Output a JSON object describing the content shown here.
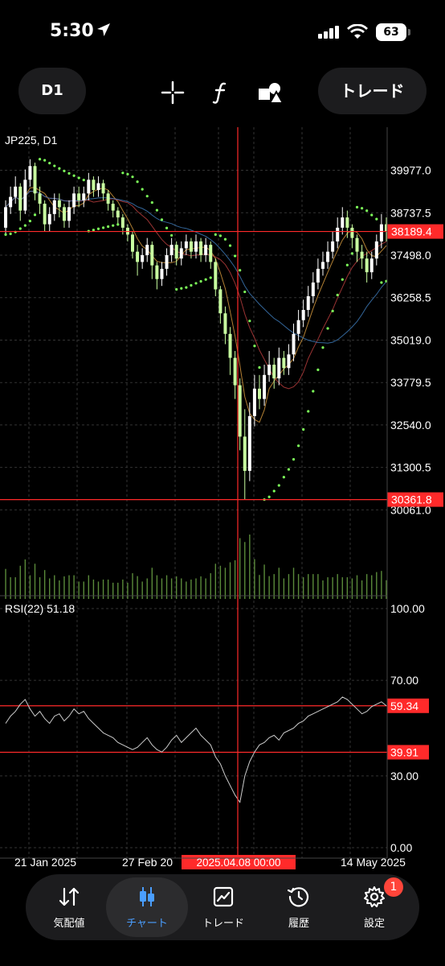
{
  "status_bar": {
    "time": "5:30",
    "battery": "63"
  },
  "toolbar": {
    "timeframe": "D1",
    "trade_button": "トレード"
  },
  "chart_data": [
    {
      "type": "candlestick",
      "title": "JP225, D1",
      "y_ticks": [
        "39977.0",
        "38737.5",
        "37498.0",
        "36258.5",
        "35019.0",
        "33779.5",
        "32540.0",
        "31300.5",
        "30061.0"
      ],
      "price_lines": [
        {
          "label": "38189.4",
          "value": 38189.4
        },
        {
          "label": "30361.8",
          "value": 30361.8
        }
      ],
      "ylim": [
        29600,
        41000
      ],
      "x_ticks": [
        "21 Jan 2025",
        "27 Feb 20",
        "14 May 2025"
      ],
      "crosshair_label": "2025.04.08 00:00",
      "candles": [
        {
          "o": 38300,
          "c": 38900,
          "h": 39100,
          "l": 38100
        },
        {
          "o": 38900,
          "c": 39200,
          "h": 39500,
          "l": 38700
        },
        {
          "o": 39200,
          "c": 39500,
          "h": 39800,
          "l": 39000
        },
        {
          "o": 39500,
          "c": 38800,
          "h": 39600,
          "l": 38500
        },
        {
          "o": 38800,
          "c": 39700,
          "h": 40000,
          "l": 38700
        },
        {
          "o": 39700,
          "c": 40100,
          "h": 40300,
          "l": 39500
        },
        {
          "o": 40100,
          "c": 39300,
          "h": 40200,
          "l": 39100
        },
        {
          "o": 39300,
          "c": 39000,
          "h": 39500,
          "l": 38700
        },
        {
          "o": 39000,
          "c": 38400,
          "h": 39100,
          "l": 38200
        },
        {
          "o": 38400,
          "c": 38700,
          "h": 38900,
          "l": 38200
        },
        {
          "o": 38700,
          "c": 39100,
          "h": 39300,
          "l": 38500
        },
        {
          "o": 39100,
          "c": 38900,
          "h": 39300,
          "l": 38600
        },
        {
          "o": 38900,
          "c": 38500,
          "h": 39000,
          "l": 38300
        },
        {
          "o": 38500,
          "c": 38900,
          "h": 39100,
          "l": 38300
        },
        {
          "o": 38900,
          "c": 39300,
          "h": 39500,
          "l": 38700
        },
        {
          "o": 39300,
          "c": 39100,
          "h": 39500,
          "l": 38900
        },
        {
          "o": 39100,
          "c": 39300,
          "h": 39500,
          "l": 38900
        },
        {
          "o": 39300,
          "c": 39700,
          "h": 39900,
          "l": 39100
        },
        {
          "o": 39700,
          "c": 39400,
          "h": 39800,
          "l": 39200
        },
        {
          "o": 39400,
          "c": 39600,
          "h": 39800,
          "l": 39200
        },
        {
          "o": 39600,
          "c": 39300,
          "h": 39700,
          "l": 39100
        },
        {
          "o": 39300,
          "c": 39000,
          "h": 39400,
          "l": 38800
        },
        {
          "o": 39000,
          "c": 38800,
          "h": 39100,
          "l": 38600
        },
        {
          "o": 38800,
          "c": 38600,
          "h": 38900,
          "l": 38400
        },
        {
          "o": 38600,
          "c": 38300,
          "h": 38700,
          "l": 38100
        },
        {
          "o": 38300,
          "c": 38100,
          "h": 38400,
          "l": 37900
        },
        {
          "o": 38100,
          "c": 37600,
          "h": 38200,
          "l": 37400
        },
        {
          "o": 37600,
          "c": 37300,
          "h": 37800,
          "l": 36900
        },
        {
          "o": 37300,
          "c": 37500,
          "h": 37700,
          "l": 37100
        },
        {
          "o": 37500,
          "c": 37800,
          "h": 38000,
          "l": 37300
        },
        {
          "o": 37800,
          "c": 37200,
          "h": 37900,
          "l": 36800
        },
        {
          "o": 37200,
          "c": 36800,
          "h": 37300,
          "l": 36500
        },
        {
          "o": 36800,
          "c": 37100,
          "h": 37300,
          "l": 36600
        },
        {
          "o": 37100,
          "c": 37500,
          "h": 37700,
          "l": 36900
        },
        {
          "o": 37500,
          "c": 37800,
          "h": 38000,
          "l": 37300
        },
        {
          "o": 37800,
          "c": 37400,
          "h": 37900,
          "l": 37200
        },
        {
          "o": 37400,
          "c": 37700,
          "h": 37900,
          "l": 37200
        },
        {
          "o": 37700,
          "c": 37900,
          "h": 38100,
          "l": 37500
        },
        {
          "o": 37900,
          "c": 37600,
          "h": 38000,
          "l": 37400
        },
        {
          "o": 37600,
          "c": 37900,
          "h": 38100,
          "l": 37400
        },
        {
          "o": 37900,
          "c": 37500,
          "h": 38000,
          "l": 37300
        },
        {
          "o": 37500,
          "c": 37800,
          "h": 38000,
          "l": 37300
        },
        {
          "o": 37800,
          "c": 37300,
          "h": 37900,
          "l": 37100
        },
        {
          "o": 37300,
          "c": 36500,
          "h": 37400,
          "l": 36300
        },
        {
          "o": 36500,
          "c": 35800,
          "h": 36600,
          "l": 35500
        },
        {
          "o": 35800,
          "c": 35200,
          "h": 36000,
          "l": 34900
        },
        {
          "o": 35200,
          "c": 34500,
          "h": 35400,
          "l": 34000
        },
        {
          "o": 34500,
          "c": 33700,
          "h": 34700,
          "l": 33300
        },
        {
          "o": 33700,
          "c": 32200,
          "h": 33900,
          "l": 31800
        },
        {
          "o": 32200,
          "c": 31200,
          "h": 33000,
          "l": 30361.8
        },
        {
          "o": 31200,
          "c": 32800,
          "h": 33200,
          "l": 30900
        },
        {
          "o": 32800,
          "c": 33600,
          "h": 34000,
          "l": 32500
        },
        {
          "o": 33600,
          "c": 33300,
          "h": 34000,
          "l": 33000
        },
        {
          "o": 33300,
          "c": 34000,
          "h": 34300,
          "l": 33100
        },
        {
          "o": 34000,
          "c": 34300,
          "h": 34700,
          "l": 33800
        },
        {
          "o": 34300,
          "c": 33900,
          "h": 34500,
          "l": 33600
        },
        {
          "o": 33900,
          "c": 34500,
          "h": 34800,
          "l": 33700
        },
        {
          "o": 34500,
          "c": 34200,
          "h": 34700,
          "l": 34000
        },
        {
          "o": 34200,
          "c": 34600,
          "h": 34900,
          "l": 34000
        },
        {
          "o": 34600,
          "c": 35200,
          "h": 35500,
          "l": 34400
        },
        {
          "o": 35200,
          "c": 35600,
          "h": 35900,
          "l": 35000
        },
        {
          "o": 35600,
          "c": 35900,
          "h": 36200,
          "l": 35400
        },
        {
          "o": 35900,
          "c": 36300,
          "h": 36600,
          "l": 35700
        },
        {
          "o": 36300,
          "c": 36700,
          "h": 37000,
          "l": 36100
        },
        {
          "o": 36700,
          "c": 37100,
          "h": 37400,
          "l": 36500
        },
        {
          "o": 37100,
          "c": 37300,
          "h": 37600,
          "l": 36900
        },
        {
          "o": 37300,
          "c": 37600,
          "h": 37900,
          "l": 37100
        },
        {
          "o": 37600,
          "c": 37900,
          "h": 38200,
          "l": 37400
        },
        {
          "o": 37900,
          "c": 38300,
          "h": 38600,
          "l": 37700
        },
        {
          "o": 38300,
          "c": 38600,
          "h": 38900,
          "l": 38100
        },
        {
          "o": 38600,
          "c": 38300,
          "h": 38800,
          "l": 38000
        },
        {
          "o": 38300,
          "c": 38000,
          "h": 38400,
          "l": 37700
        },
        {
          "o": 38000,
          "c": 37600,
          "h": 38100,
          "l": 37300
        },
        {
          "o": 37600,
          "c": 37400,
          "h": 37800,
          "l": 37100
        },
        {
          "o": 37400,
          "c": 37000,
          "h": 37600,
          "l": 36700
        },
        {
          "o": 37000,
          "c": 37400,
          "h": 37600,
          "l": 36800
        },
        {
          "o": 37400,
          "c": 37900,
          "h": 38100,
          "l": 37200
        },
        {
          "o": 37900,
          "c": 38400,
          "h": 38700,
          "l": 37700
        },
        {
          "o": 38400,
          "c": 38189.4,
          "h": 38600,
          "l": 37900
        }
      ],
      "volume_note": "volume histogram"
    },
    {
      "type": "line",
      "title": "RSI(22) 51.18",
      "y_ticks": [
        "100.00",
        "70.00",
        "30.00",
        "0.00"
      ],
      "price_lines": [
        {
          "label": "59.34",
          "value": 59.34
        },
        {
          "label": "39.91",
          "value": 39.91
        }
      ],
      "ylim": [
        0,
        100
      ],
      "values": [
        52,
        55,
        57,
        60,
        62,
        58,
        55,
        57,
        54,
        52,
        55,
        56,
        53,
        55,
        58,
        56,
        57,
        54,
        52,
        50,
        48,
        47,
        46,
        44,
        43,
        42,
        41,
        42,
        44,
        46,
        43,
        41,
        40,
        42,
        45,
        47,
        44,
        46,
        48,
        50,
        47,
        45,
        43,
        38,
        35,
        30,
        26,
        22,
        19,
        30,
        36,
        40,
        43,
        44,
        46,
        47,
        45,
        48,
        49,
        50,
        52,
        53,
        55,
        56,
        57,
        58,
        59,
        60,
        61,
        63,
        62,
        60,
        58,
        56,
        57,
        59,
        60,
        61,
        59.34
      ]
    }
  ],
  "nav": [
    {
      "label": "気配値",
      "icon": "quotes-icon"
    },
    {
      "label": "チャート",
      "icon": "chart-candles-icon"
    },
    {
      "label": "トレード",
      "icon": "trade-chart-icon"
    },
    {
      "label": "履歴",
      "icon": "history-icon"
    },
    {
      "label": "設定",
      "icon": "gear-icon"
    }
  ],
  "badge": "1",
  "colors": {
    "bull": "#ffffff",
    "bear": "#c8ffa0",
    "sar": "#7dff5a",
    "crosshair": "#ff2a2a",
    "accent": "#4a9eff"
  }
}
